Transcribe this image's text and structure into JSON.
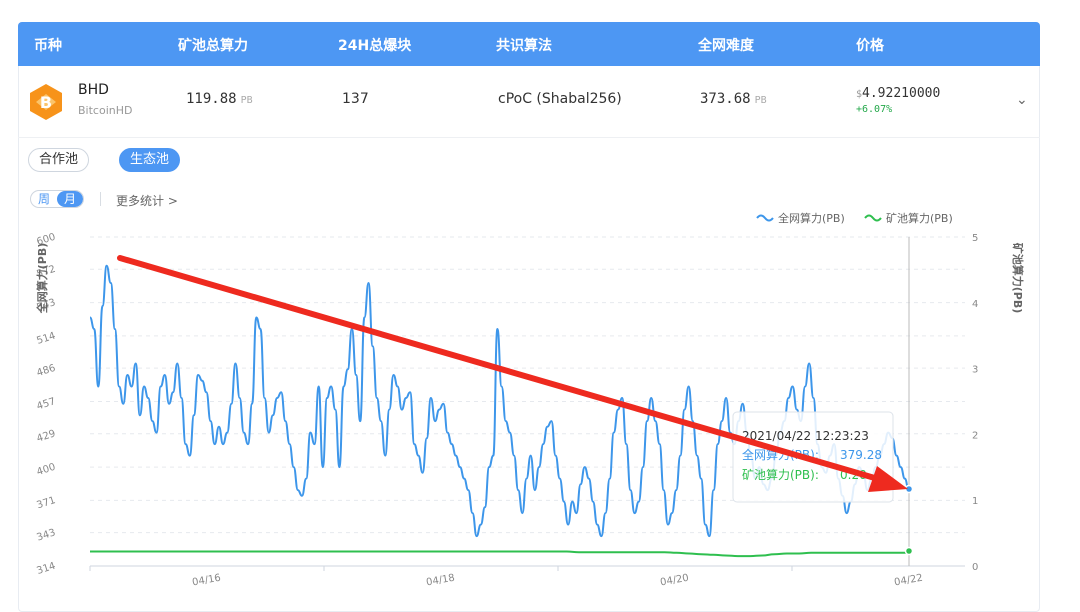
{
  "header": {
    "col_coin": "币种",
    "col_pool_power": "矿池总算力",
    "col_blocks": "24H总爆块",
    "col_algo": "共识算法",
    "col_difficulty": "全网难度",
    "col_price": "价格"
  },
  "coin": {
    "name": "BHD",
    "full_name": "BitcoinHD",
    "pool_power": "119.88",
    "pool_power_unit": "PB",
    "blocks": "137",
    "algorithm": "cPoC (Shabal256)",
    "difficulty": "373.68",
    "difficulty_unit": "PB",
    "price_currency": "$",
    "price": "4.92210000",
    "change": "+6.07%",
    "logo_color": "#f7931a",
    "change_color": "#23a84a"
  },
  "pool_tabs": [
    "合作池",
    "生态池"
  ],
  "active_pool_tab": "生态池",
  "period_tabs": [
    "周",
    "月"
  ],
  "active_period": "月",
  "more_stats": "更多统计 >",
  "tooltip": {
    "time": "2021/04/22 12:23:23",
    "network_label": "全网算力(PB):",
    "network_value": "379.28",
    "pool_label": "矿池算力(PB):",
    "pool_value": "0.20"
  },
  "chart_data": {
    "type": "line",
    "left_axis": {
      "label": "全网算力(PB)",
      "ticks": [
        314,
        343,
        371,
        400,
        429,
        457,
        486,
        514,
        543,
        572,
        600
      ],
      "ylim": [
        314,
        600
      ]
    },
    "right_axis": {
      "label": "矿池算力(PB)",
      "ticks": [
        0,
        1,
        2,
        3,
        4,
        5
      ],
      "ylim": [
        0,
        5
      ]
    },
    "x_ticks": [
      "04/16",
      "04/18",
      "04/20",
      "04/22"
    ],
    "legend": [
      {
        "name": "全网算力(PB)",
        "color": "#3d96ea"
      },
      {
        "name": "矿池算力(PB)",
        "color": "#2fbf4f"
      }
    ],
    "legend_position": "top-right",
    "grid": "horizontal-dashed",
    "series": [
      {
        "name": "全网算力(PB)",
        "axis": "left",
        "color": "#3d96ea",
        "values": [
          530,
          520,
          470,
          540,
          575,
          560,
          520,
          470,
          455,
          480,
          470,
          490,
          445,
          470,
          460,
          440,
          430,
          470,
          480,
          455,
          465,
          490,
          460,
          420,
          410,
          445,
          480,
          475,
          465,
          440,
          420,
          435,
          420,
          430,
          455,
          490,
          460,
          430,
          420,
          455,
          530,
          520,
          460,
          430,
          445,
          460,
          465,
          440,
          420,
          400,
          380,
          375,
          390,
          430,
          420,
          470,
          400,
          460,
          470,
          450,
          400,
          470,
          485,
          520,
          480,
          440,
          530,
          560,
          505,
          460,
          440,
          410,
          450,
          480,
          470,
          450,
          460,
          465,
          420,
          410,
          395,
          425,
          460,
          440,
          450,
          455,
          430,
          420,
          410,
          400,
          390,
          380,
          360,
          340,
          350,
          365,
          400,
          410,
          520,
          470,
          440,
          430,
          410,
          380,
          360,
          390,
          410,
          380,
          400,
          420,
          435,
          440,
          410,
          390,
          370,
          350,
          370,
          360,
          385,
          400,
          390,
          370,
          350,
          340,
          360,
          390,
          430,
          450,
          460,
          420,
          380,
          360,
          370,
          400,
          440,
          460,
          440,
          420,
          380,
          350,
          360,
          380,
          410,
          450,
          470,
          440,
          410,
          390,
          350,
          340,
          380,
          420,
          440,
          460,
          430,
          420,
          440,
          455,
          430,
          410,
          390,
          400,
          385,
          380,
          390,
          410,
          430,
          440,
          460,
          470,
          450,
          440,
          470,
          490,
          460,
          420,
          400,
          395,
          410,
          420,
          390,
          375,
          360,
          370,
          385,
          400,
          395,
          380,
          390,
          400,
          410,
          420,
          430,
          425,
          410,
          400,
          390,
          379.28
        ]
      },
      {
        "name": "矿池算力(PB)",
        "axis": "right",
        "color": "#2fbf4f",
        "values": [
          0.22,
          0.22,
          0.22,
          0.22,
          0.22,
          0.22,
          0.22,
          0.22,
          0.22,
          0.22,
          0.22,
          0.22,
          0.22,
          0.22,
          0.22,
          0.22,
          0.22,
          0.22,
          0.22,
          0.22,
          0.22,
          0.22,
          0.22,
          0.22,
          0.22,
          0.22,
          0.22,
          0.22,
          0.22,
          0.22,
          0.22,
          0.22,
          0.22,
          0.22,
          0.22,
          0.22,
          0.22,
          0.22,
          0.22,
          0.22,
          0.21,
          0.21,
          0.21,
          0.21,
          0.21,
          0.21,
          0.21,
          0.21,
          0.2,
          0.19,
          0.18,
          0.17,
          0.16,
          0.15,
          0.15,
          0.16,
          0.18,
          0.19,
          0.19,
          0.2,
          0.2,
          0.2,
          0.2,
          0.2,
          0.2,
          0.2,
          0.2,
          0.2
        ]
      }
    ]
  }
}
